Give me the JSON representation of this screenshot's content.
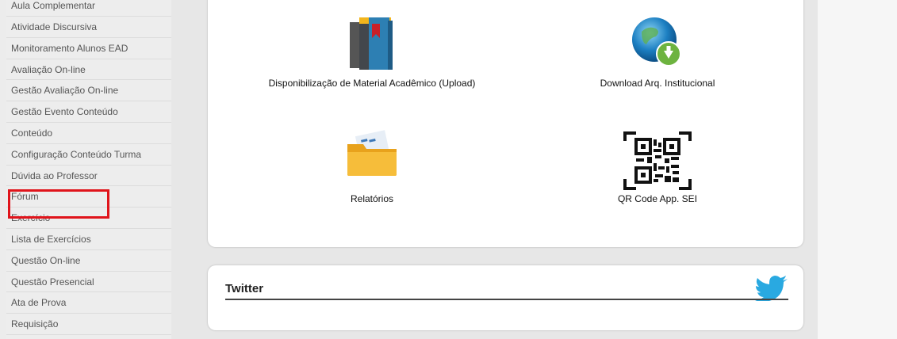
{
  "sidebar": {
    "items": [
      {
        "label": "Aula Complementar"
      },
      {
        "label": "Atividade Discursiva"
      },
      {
        "label": "Monitoramento Alunos EAD"
      },
      {
        "label": "Avaliação On-line"
      },
      {
        "label": "Gestão Avaliação On-line"
      },
      {
        "label": "Gestão Evento Conteúdo"
      },
      {
        "label": "Conteúdo"
      },
      {
        "label": "Configuração Conteúdo Turma"
      },
      {
        "label": "Dúvida ao Professor"
      },
      {
        "label": "Fórum"
      },
      {
        "label": "Exercício"
      },
      {
        "label": "Lista de Exercícios"
      },
      {
        "label": "Questão On-line"
      },
      {
        "label": "Questão Presencial"
      },
      {
        "label": "Ata de Prova"
      },
      {
        "label": "Requisição"
      }
    ],
    "highlight_color": "#e0141b"
  },
  "apps": {
    "material": {
      "label": "Disponibilização de Material Acadêmico (Upload)",
      "icon": "book-icon"
    },
    "download": {
      "label": "Download Arq. Institucional",
      "icon": "globe-download-icon"
    },
    "reports": {
      "label": "Relatórios",
      "icon": "folder-icon"
    },
    "qrcode": {
      "label": "QR Code App. SEI",
      "icon": "qr-code-icon"
    }
  },
  "twitter": {
    "title": "Twitter",
    "icon": "twitter-bird-icon",
    "brand_color": "#29a9e1"
  }
}
